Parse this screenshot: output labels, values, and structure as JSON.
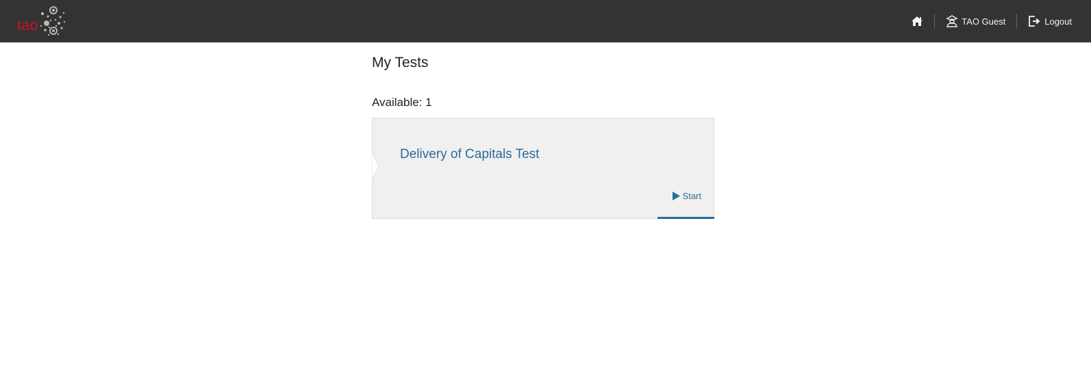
{
  "header": {
    "logo_text": "tao",
    "user_label": "TAO Guest",
    "logout_label": "Logout",
    "colors": {
      "background": "#333333",
      "logo": "#c8102e",
      "text": "#f5f5f5"
    }
  },
  "main": {
    "title": "My Tests",
    "available_label": "Available: 1",
    "tests": [
      {
        "title": "Delivery of Capitals Test",
        "action_label": "Start"
      }
    ],
    "colors": {
      "card": "#f1f0ef",
      "link": "#266d9c"
    }
  }
}
